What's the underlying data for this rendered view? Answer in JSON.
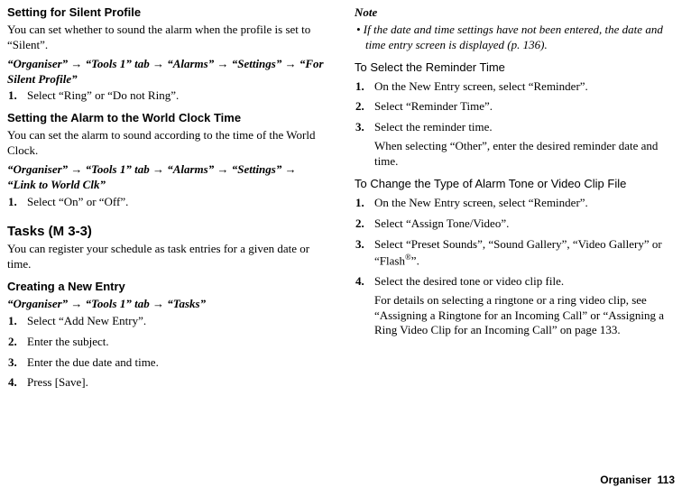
{
  "left": {
    "silent": {
      "heading": "Setting for Silent Profile",
      "body": "You can set whether to sound the alarm when the profile is set to “Silent”.",
      "path": "“Organiser” → “Tools 1” tab → “Alarms” → “Settings” → “For Silent Profile”",
      "step1": "Select “Ring” or “Do not Ring”."
    },
    "worldclock": {
      "heading": "Setting the Alarm to the World Clock Time",
      "body": "You can set the alarm to sound according to the time of the World Clock.",
      "path": "“Organiser” → “Tools 1” tab → “Alarms” → “Settings” → “Link to World Clk”",
      "step1": "Select “On” or “Off”."
    },
    "tasks": {
      "heading": "Tasks (M 3-3)",
      "body": "You can register your schedule as task entries for a given date or time.",
      "create_heading": "Creating a New Entry",
      "path": "“Organiser” → “Tools 1” tab → “Tasks”",
      "step1": "Select “Add New Entry”.",
      "step2": "Enter the subject.",
      "step3": "Enter the due date and time.",
      "step4": "Press [Save]."
    }
  },
  "right": {
    "note_label": "Note",
    "note_item": "• If the date and time settings have not been entered, the date and time entry screen is displayed (p. 136).",
    "reminder": {
      "heading": "To Select the Reminder Time",
      "step1": "On the New Entry screen, select “Reminder”.",
      "step2": "Select “Reminder Time”.",
      "step3": "Select the reminder time.",
      "step3b": "When selecting “Other”, enter the desired reminder date and time."
    },
    "alarmtone": {
      "heading": "To Change the Type of Alarm Tone or Video Clip File",
      "step1": "On the New Entry screen, select “Reminder”.",
      "step2": "Select “Assign Tone/Video”.",
      "step3a": "Select “Preset Sounds”, “Sound Gallery”, “Video Gallery” or “Flash",
      "step3b": "”.",
      "step4": "Select the desired tone or video clip file.",
      "step4b": "For details on selecting a ringtone or a ring video clip, see “Assigning a Ringtone for an Incoming Call” or “Assigning a Ring Video Clip for an Incoming Call” on page 133."
    }
  },
  "footer": {
    "label": "Organiser",
    "page": "113"
  }
}
